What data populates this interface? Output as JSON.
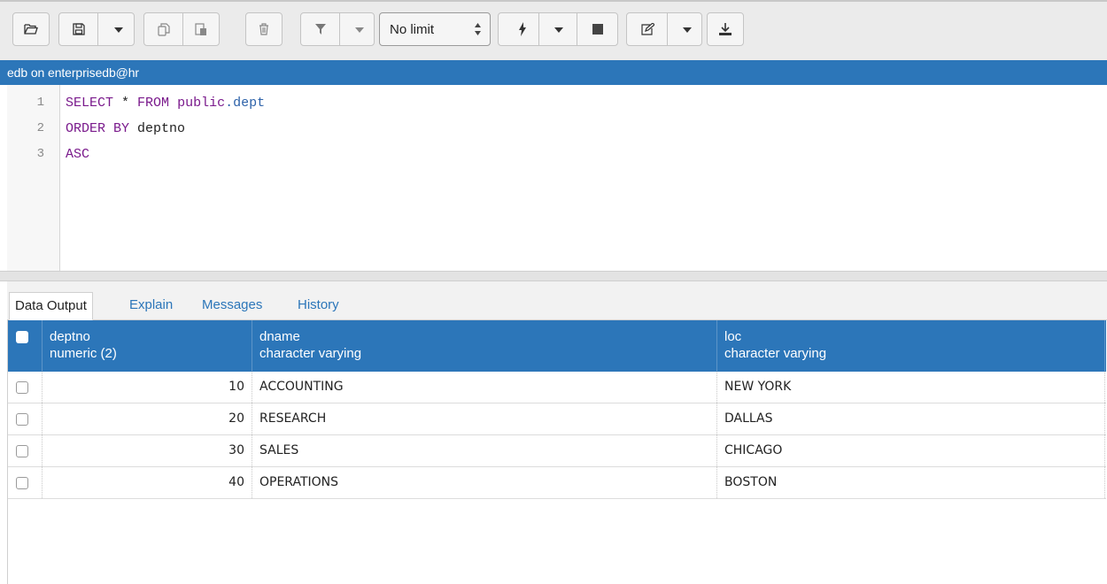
{
  "toolbar": {
    "buttons": [
      {
        "name": "open-file-icon"
      },
      {
        "name": "save-icon"
      },
      {
        "name": "copy-icon"
      },
      {
        "name": "paste-icon"
      },
      {
        "name": "delete-icon"
      },
      {
        "name": "filter-icon"
      },
      {
        "name": "execute-icon"
      },
      {
        "name": "stop-icon"
      },
      {
        "name": "edit-icon"
      },
      {
        "name": "download-icon"
      }
    ],
    "row_limit": "No limit"
  },
  "connection": {
    "label": "edb on enterprisedb@hr"
  },
  "editor": {
    "lines": [
      {
        "number": "1",
        "parts": [
          {
            "t": "SELECT",
            "c": "kw"
          },
          {
            "t": " * ",
            "c": ""
          },
          {
            "t": "FROM",
            "c": "kw"
          },
          {
            "t": " ",
            "c": ""
          },
          {
            "t": "public",
            "c": "kw"
          },
          {
            "t": ".dept",
            "c": "id"
          }
        ]
      },
      {
        "number": "2",
        "parts": [
          {
            "t": "ORDER BY",
            "c": "kw"
          },
          {
            "t": " deptno",
            "c": ""
          }
        ]
      },
      {
        "number": "3",
        "parts": [
          {
            "t": "ASC",
            "c": "kw"
          }
        ]
      }
    ]
  },
  "tabs": [
    {
      "label": "Data Output",
      "active": true
    },
    {
      "label": "Explain",
      "active": false
    },
    {
      "label": "Messages",
      "active": false
    },
    {
      "label": "History",
      "active": false
    }
  ],
  "grid": {
    "columns": [
      {
        "name": "deptno",
        "type": "numeric (2)"
      },
      {
        "name": "dname",
        "type": "character varying"
      },
      {
        "name": "loc",
        "type": "character varying"
      }
    ],
    "rows": [
      {
        "deptno": "10",
        "dname": "ACCOUNTING",
        "loc": "NEW YORK"
      },
      {
        "deptno": "20",
        "dname": "RESEARCH",
        "loc": "DALLAS"
      },
      {
        "deptno": "30",
        "dname": "SALES",
        "loc": "CHICAGO"
      },
      {
        "deptno": "40",
        "dname": "OPERATIONS",
        "loc": "BOSTON"
      }
    ]
  },
  "colors": {
    "accent": "#2c76b9",
    "keyword": "#7a1a8c",
    "identifier": "#2d62a9"
  }
}
